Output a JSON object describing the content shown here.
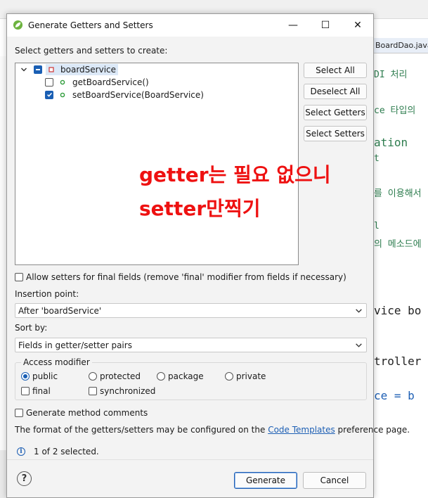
{
  "background": {
    "editor_tab": "BoardDao.java",
    "code_lines": [
      {
        "text": "DI 처리 ",
        "color": "#2e7d4f"
      },
      {
        "text": "ce 타입의",
        "color": "#2e7d4f"
      },
      {
        "text": "ation",
        "color": "#2e7d4f"
      },
      {
        "text": "t",
        "color": "#2e7d4f"
      },
      {
        "text": "를 이용해서",
        "color": "#2e7d4f"
      },
      {
        "text": "l",
        "color": "#2e7d4f"
      },
      {
        "text": "의 메소드에",
        "color": "#2e7d4f"
      },
      {
        "text": "vice bo",
        "color": "#222222"
      },
      {
        "text": "troller",
        "color": "#222222"
      },
      {
        "text": "ce = b",
        "color": "#1d5fb4"
      }
    ]
  },
  "dialog": {
    "title": "Generate Getters and Setters",
    "window_controls": {
      "minimize": "—",
      "maximize": "☐",
      "close": "✕"
    },
    "select_label": "Select getters and setters to create:",
    "tree": {
      "root": {
        "label": "boardService",
        "state": "mixed",
        "expanded": true
      },
      "children": [
        {
          "label": "getBoardService()",
          "checked": false
        },
        {
          "label": "setBoardService(BoardService)",
          "checked": true
        }
      ]
    },
    "side_buttons": {
      "select_all": "Select All",
      "deselect_all": "Deselect All",
      "select_getters": "Select Getters",
      "select_setters": "Select Setters"
    },
    "annotation": {
      "line1": "getter는 필요 없으니",
      "line2": "setter만찍기"
    },
    "allow_final": {
      "label": "Allow setters for final fields (remove 'final' modifier from fields if necessary)",
      "checked": false
    },
    "insertion_point": {
      "label": "Insertion point:",
      "value": "After 'boardService'"
    },
    "sort_by": {
      "label": "Sort by:",
      "value": "Fields in getter/setter pairs"
    },
    "access_modifier": {
      "legend": "Access modifier",
      "options": {
        "public": "public",
        "protected": "protected",
        "package": "package",
        "private": "private"
      },
      "selected": "public",
      "final": {
        "label": "final",
        "checked": false
      },
      "synchronized": {
        "label": "synchronized",
        "checked": false
      }
    },
    "generate_comments": {
      "label": "Generate method comments",
      "checked": false
    },
    "format_text": {
      "before": "The format of the getters/setters may be configured on the ",
      "link": "Code Templates",
      "after": " preference page."
    },
    "status": "1 of 2 selected.",
    "buttons": {
      "generate": "Generate",
      "cancel": "Cancel"
    },
    "help": "?",
    "colors": {
      "accent": "#1a5fb4",
      "annotation": "#ee1111",
      "link": "#1d5fb4"
    }
  }
}
